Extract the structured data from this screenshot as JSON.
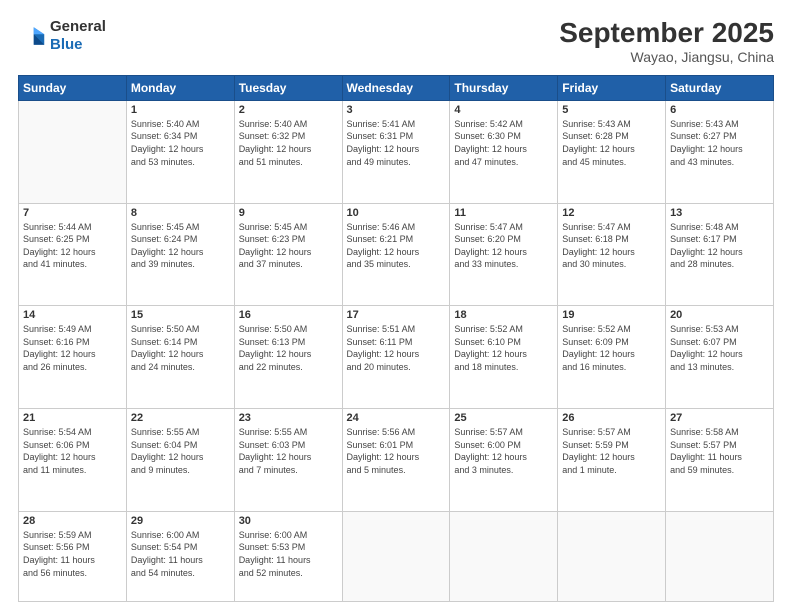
{
  "logo": {
    "line1": "General",
    "line2": "Blue"
  },
  "header": {
    "month": "September 2025",
    "location": "Wayao, Jiangsu, China"
  },
  "weekdays": [
    "Sunday",
    "Monday",
    "Tuesday",
    "Wednesday",
    "Thursday",
    "Friday",
    "Saturday"
  ],
  "weeks": [
    [
      {
        "day": "",
        "info": ""
      },
      {
        "day": "1",
        "info": "Sunrise: 5:40 AM\nSunset: 6:34 PM\nDaylight: 12 hours\nand 53 minutes."
      },
      {
        "day": "2",
        "info": "Sunrise: 5:40 AM\nSunset: 6:32 PM\nDaylight: 12 hours\nand 51 minutes."
      },
      {
        "day": "3",
        "info": "Sunrise: 5:41 AM\nSunset: 6:31 PM\nDaylight: 12 hours\nand 49 minutes."
      },
      {
        "day": "4",
        "info": "Sunrise: 5:42 AM\nSunset: 6:30 PM\nDaylight: 12 hours\nand 47 minutes."
      },
      {
        "day": "5",
        "info": "Sunrise: 5:43 AM\nSunset: 6:28 PM\nDaylight: 12 hours\nand 45 minutes."
      },
      {
        "day": "6",
        "info": "Sunrise: 5:43 AM\nSunset: 6:27 PM\nDaylight: 12 hours\nand 43 minutes."
      }
    ],
    [
      {
        "day": "7",
        "info": "Sunrise: 5:44 AM\nSunset: 6:25 PM\nDaylight: 12 hours\nand 41 minutes."
      },
      {
        "day": "8",
        "info": "Sunrise: 5:45 AM\nSunset: 6:24 PM\nDaylight: 12 hours\nand 39 minutes."
      },
      {
        "day": "9",
        "info": "Sunrise: 5:45 AM\nSunset: 6:23 PM\nDaylight: 12 hours\nand 37 minutes."
      },
      {
        "day": "10",
        "info": "Sunrise: 5:46 AM\nSunset: 6:21 PM\nDaylight: 12 hours\nand 35 minutes."
      },
      {
        "day": "11",
        "info": "Sunrise: 5:47 AM\nSunset: 6:20 PM\nDaylight: 12 hours\nand 33 minutes."
      },
      {
        "day": "12",
        "info": "Sunrise: 5:47 AM\nSunset: 6:18 PM\nDaylight: 12 hours\nand 30 minutes."
      },
      {
        "day": "13",
        "info": "Sunrise: 5:48 AM\nSunset: 6:17 PM\nDaylight: 12 hours\nand 28 minutes."
      }
    ],
    [
      {
        "day": "14",
        "info": "Sunrise: 5:49 AM\nSunset: 6:16 PM\nDaylight: 12 hours\nand 26 minutes."
      },
      {
        "day": "15",
        "info": "Sunrise: 5:50 AM\nSunset: 6:14 PM\nDaylight: 12 hours\nand 24 minutes."
      },
      {
        "day": "16",
        "info": "Sunrise: 5:50 AM\nSunset: 6:13 PM\nDaylight: 12 hours\nand 22 minutes."
      },
      {
        "day": "17",
        "info": "Sunrise: 5:51 AM\nSunset: 6:11 PM\nDaylight: 12 hours\nand 20 minutes."
      },
      {
        "day": "18",
        "info": "Sunrise: 5:52 AM\nSunset: 6:10 PM\nDaylight: 12 hours\nand 18 minutes."
      },
      {
        "day": "19",
        "info": "Sunrise: 5:52 AM\nSunset: 6:09 PM\nDaylight: 12 hours\nand 16 minutes."
      },
      {
        "day": "20",
        "info": "Sunrise: 5:53 AM\nSunset: 6:07 PM\nDaylight: 12 hours\nand 13 minutes."
      }
    ],
    [
      {
        "day": "21",
        "info": "Sunrise: 5:54 AM\nSunset: 6:06 PM\nDaylight: 12 hours\nand 11 minutes."
      },
      {
        "day": "22",
        "info": "Sunrise: 5:55 AM\nSunset: 6:04 PM\nDaylight: 12 hours\nand 9 minutes."
      },
      {
        "day": "23",
        "info": "Sunrise: 5:55 AM\nSunset: 6:03 PM\nDaylight: 12 hours\nand 7 minutes."
      },
      {
        "day": "24",
        "info": "Sunrise: 5:56 AM\nSunset: 6:01 PM\nDaylight: 12 hours\nand 5 minutes."
      },
      {
        "day": "25",
        "info": "Sunrise: 5:57 AM\nSunset: 6:00 PM\nDaylight: 12 hours\nand 3 minutes."
      },
      {
        "day": "26",
        "info": "Sunrise: 5:57 AM\nSunset: 5:59 PM\nDaylight: 12 hours\nand 1 minute."
      },
      {
        "day": "27",
        "info": "Sunrise: 5:58 AM\nSunset: 5:57 PM\nDaylight: 11 hours\nand 59 minutes."
      }
    ],
    [
      {
        "day": "28",
        "info": "Sunrise: 5:59 AM\nSunset: 5:56 PM\nDaylight: 11 hours\nand 56 minutes."
      },
      {
        "day": "29",
        "info": "Sunrise: 6:00 AM\nSunset: 5:54 PM\nDaylight: 11 hours\nand 54 minutes."
      },
      {
        "day": "30",
        "info": "Sunrise: 6:00 AM\nSunset: 5:53 PM\nDaylight: 11 hours\nand 52 minutes."
      },
      {
        "day": "",
        "info": ""
      },
      {
        "day": "",
        "info": ""
      },
      {
        "day": "",
        "info": ""
      },
      {
        "day": "",
        "info": ""
      }
    ]
  ]
}
